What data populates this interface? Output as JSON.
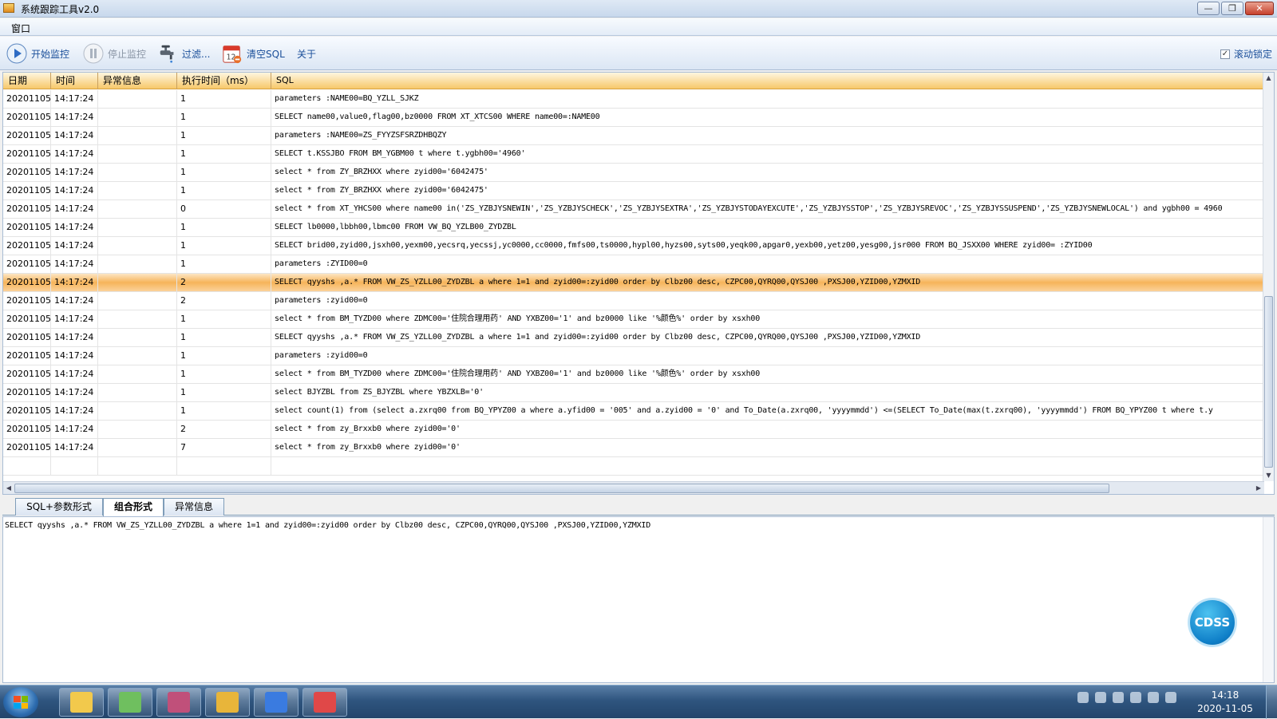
{
  "window": {
    "title": "系统跟踪工具v2.0",
    "min_glyph": "—",
    "max_glyph": "❐",
    "close_glyph": "✕"
  },
  "menu": {
    "items": [
      "窗口"
    ]
  },
  "toolbar": {
    "start": "开始监控",
    "stop": "停止监控",
    "filter": "过滤...",
    "clear_sql": "清空SQL",
    "about": "关于",
    "scroll_lock": "滚动锁定",
    "scroll_lock_checked": true
  },
  "grid": {
    "columns": [
      "日期",
      "时间",
      "异常信息",
      "执行时间（ms）",
      "SQL"
    ],
    "selected_index": 10,
    "rows": [
      [
        "20201105",
        "14:17:24",
        "",
        "1",
        "parameters :NAME00=BQ_YZLL_SJKZ"
      ],
      [
        "20201105",
        "14:17:24",
        "",
        "1",
        "SELECT name00,value0,flag00,bz0000 FROM XT_XTCS00 WHERE name00=:NAME00"
      ],
      [
        "20201105",
        "14:17:24",
        "",
        "1",
        "parameters :NAME00=ZS_FYYZSFSRZDHBQZY"
      ],
      [
        "20201105",
        "14:17:24",
        "",
        "1",
        " SELECT t.KSSJBO FROM BM_YGBM00 t where t.ygbh00='4960'"
      ],
      [
        "20201105",
        "14:17:24",
        "",
        "1",
        "select * from ZY_BRZHXX where zyid00='6042475'"
      ],
      [
        "20201105",
        "14:17:24",
        "",
        "1",
        "select * from ZY_BRZHXX where zyid00='6042475'"
      ],
      [
        "20201105",
        "14:17:24",
        "",
        "0",
        "select * from XT_YHCS00 where name00 in('ZS_YZBJYSNEWIN','ZS_YZBJYSCHECK','ZS_YZBJYSEXTRA','ZS_YZBJYSTODAYEXCUTE','ZS_YZBJYSSTOP','ZS_YZBJYSREVOC','ZS_YZBJYSSUSPEND','ZS_YZBJYSNEWLOCAL') and ygbh00 = 4960"
      ],
      [
        "20201105",
        "14:17:24",
        "",
        "1",
        "SELECT lb0000,lbbh00,lbmc00 FROM VW_BQ_YZLB00_ZYDZBL"
      ],
      [
        "20201105",
        "14:17:24",
        "",
        "1",
        "SELECT brid00,zyid00,jsxh00,yexm00,yecsrq,yecssj,yc0000,cc0000,fmfs00,ts0000,hypl00,hyzs00,syts00,yeqk00,apgar0,yexb00,yetz00,yesg00,jsr000 FROM BQ_JSXX00 WHERE zyid00= :ZYID00"
      ],
      [
        "20201105",
        "14:17:24",
        "",
        "1",
        "parameters :ZYID00=0"
      ],
      [
        "20201105",
        "14:17:24",
        "",
        "2",
        "SELECT qyyshs ,a.* FROM VW_ZS_YZLL00_ZYDZBL a  where 1=1 and zyid00=:zyid00  order by Clbz00 desc, CZPC00,QYRQ00,QYSJ00 ,PXSJ00,YZID00,YZMXID"
      ],
      [
        "20201105",
        "14:17:24",
        "",
        "2",
        "parameters :zyid00=0"
      ],
      [
        "20201105",
        "14:17:24",
        "",
        "1",
        "select * from BM_TYZD00 where ZDMC00='住院合理用药' AND YXBZ00='1' and bz0000 like '%颜色%' order by xsxh00"
      ],
      [
        "20201105",
        "14:17:24",
        "",
        "1",
        "SELECT qyyshs ,a.* FROM VW_ZS_YZLL00_ZYDZBL a  where 1=1 and zyid00=:zyid00  order by Clbz00 desc, CZPC00,QYRQ00,QYSJ00 ,PXSJ00,YZID00,YZMXID"
      ],
      [
        "20201105",
        "14:17:24",
        "",
        "1",
        "parameters :zyid00=0"
      ],
      [
        "20201105",
        "14:17:24",
        "",
        "1",
        "select * from BM_TYZD00 where ZDMC00='住院合理用药' AND YXBZ00='1' and bz0000 like '%颜色%' order by xsxh00"
      ],
      [
        "20201105",
        "14:17:24",
        "",
        "1",
        "select BJYZBL   from ZS_BJYZBL where YBZXLB='0'"
      ],
      [
        "20201105",
        "14:17:24",
        "",
        "1",
        " select count(1) from (select a.zxrq00 from BQ_YPYZ00 a where a.yfid00 = '005'  and a.zyid00 = '0'  and To_Date(a.zxrq00, 'yyyymmdd') <=(SELECT To_Date(max(t.zxrq00), 'yyyymmdd') FROM BQ_YPYZ00 t where t.y"
      ],
      [
        "20201105",
        "14:17:24",
        "",
        "2",
        "select * from zy_Brxxb0 where zyid00='0'"
      ],
      [
        "20201105",
        "14:17:24",
        "",
        "7",
        "select * from zy_Brxxb0 where zyid00='0'"
      ]
    ]
  },
  "tabs": [
    {
      "label": "SQL+参数形式",
      "active": false
    },
    {
      "label": "组合形式",
      "active": true
    },
    {
      "label": "异常信息",
      "active": false
    }
  ],
  "detail": {
    "text": "SELECT qyyshs ,a.* FROM VW_ZS_YZLL00_ZYDZBL a  where 1=1 and zyid00=:zyid00  order by Clbz00 desc, CZPC00,QYRQ00,QYSJ00 ,PXSJ00,YZID00,YZMXID"
  },
  "floating": {
    "cdss": "CDSS"
  },
  "taskbar": {
    "time": "14:18",
    "date": "2020-11-05",
    "apps": [
      "explorer-icon",
      "notepad-icon",
      "database-icon",
      "sql-icon",
      "sogou-icon",
      "medical-icon"
    ],
    "app_colors": [
      "#f2c94c",
      "#6fbf5f",
      "#c0507a",
      "#e8b53a",
      "#3a7be0",
      "#e04848"
    ]
  }
}
